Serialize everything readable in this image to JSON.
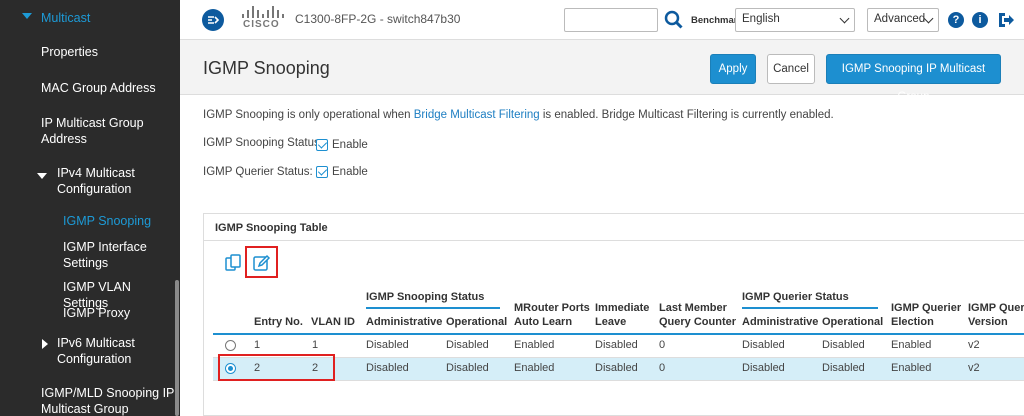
{
  "sidebar": {
    "multicast": "Multicast",
    "items": [
      {
        "label": "Properties"
      },
      {
        "label": "MAC Group Address"
      },
      {
        "label": "IP Multicast Group Address"
      },
      {
        "label": "IPv4 Multicast Configuration"
      },
      {
        "label": "IGMP Snooping"
      },
      {
        "label": "IGMP Interface Settings"
      },
      {
        "label": "IGMP VLAN Settings"
      },
      {
        "label": "IGMP Proxy"
      },
      {
        "label": "IPv6 Multicast Configuration"
      },
      {
        "label": "IGMP/MLD Snooping IP Multicast Group"
      }
    ]
  },
  "header": {
    "cisco_text": "CISCO",
    "device": "C1300-8FP-2G - switch847b30",
    "search_placeholder": "",
    "benchmark": "Benchmark",
    "language": "English",
    "mode": "Advanced",
    "help": "?",
    "info": "i"
  },
  "page": {
    "title": "IGMP Snooping",
    "apply": "Apply",
    "cancel": "Cancel",
    "group_button": "IGMP Snooping IP Multicast Group"
  },
  "info": {
    "pre": "IGMP Snooping is only operational when ",
    "link": "Bridge Multicast Filtering",
    "post": " is enabled. Bridge Multicast Filtering is currently enabled."
  },
  "fields": {
    "snooping_status_label": "IGMP Snooping Status:",
    "snooping_status_value": "Enable",
    "querier_status_label": "IGMP Querier Status:",
    "querier_status_value": "Enable"
  },
  "table": {
    "title": "IGMP Snooping Table",
    "group_snooping": "IGMP Snooping Status",
    "group_querier": "IGMP Querier Status",
    "columns": {
      "entry": "Entry No.",
      "vlan": "VLAN ID",
      "snoop_admin": "Administrative",
      "snoop_oper": "Operational",
      "mrouter_1": "MRouter Ports",
      "mrouter_2": "Auto Learn",
      "immediate_1": "Immediate",
      "immediate_2": "Leave",
      "lmqc_1": "Last Member",
      "lmqc_2": "Query Counter",
      "q_admin": "Administrative",
      "q_oper": "Operational",
      "election_1": "IGMP Querier",
      "election_2": "Election",
      "version_1": "IGMP Querier",
      "version_2": "Version"
    },
    "rows": [
      {
        "entry": "1",
        "vlan": "1",
        "snoop_admin": "Disabled",
        "snoop_oper": "Disabled",
        "mrouter": "Enabled",
        "immediate": "Disabled",
        "lmqc": "0",
        "q_admin": "Disabled",
        "q_oper": "Disabled",
        "election": "Enabled",
        "version": "v2",
        "selected": false
      },
      {
        "entry": "2",
        "vlan": "2",
        "snoop_admin": "Disabled",
        "snoop_oper": "Disabled",
        "mrouter": "Enabled",
        "immediate": "Disabled",
        "lmqc": "0",
        "q_admin": "Disabled",
        "q_oper": "Disabled",
        "election": "Enabled",
        "version": "v2",
        "selected": true
      }
    ]
  },
  "colors": {
    "accent": "#1d8fd0",
    "sidebar_bg": "#2b2b2b",
    "active_link": "#1d9ad6",
    "highlight": "#e02020",
    "selected_row": "#d5eef8"
  },
  "icons": [
    "menu-icon",
    "cisco-logo",
    "search-icon",
    "help-icon",
    "info-icon",
    "logout-icon",
    "copy-settings-icon",
    "edit-icon"
  ]
}
